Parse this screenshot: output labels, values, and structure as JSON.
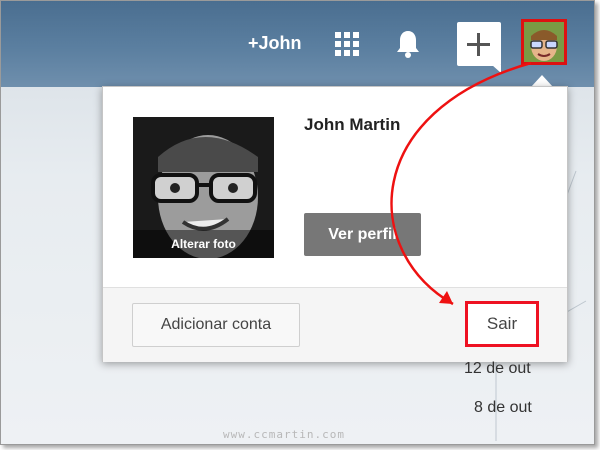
{
  "header": {
    "profile_link": "+John",
    "apps_icon": "apps-grid-icon",
    "notifications_icon": "bell-icon",
    "share_icon": "plus-share-icon"
  },
  "account_menu": {
    "photo_caption": "Alterar foto",
    "name": "John Martin",
    "view_profile": "Ver perfil",
    "add_account": "Adicionar conta",
    "sign_out": "Sair"
  },
  "background_list": {
    "dates": [
      "12 de out",
      "8 de out"
    ]
  },
  "watermark": "www.ccmartin.com",
  "colors": {
    "topbar": "#5b7fa0",
    "highlight": "#e11111",
    "button_gray": "#777777"
  }
}
